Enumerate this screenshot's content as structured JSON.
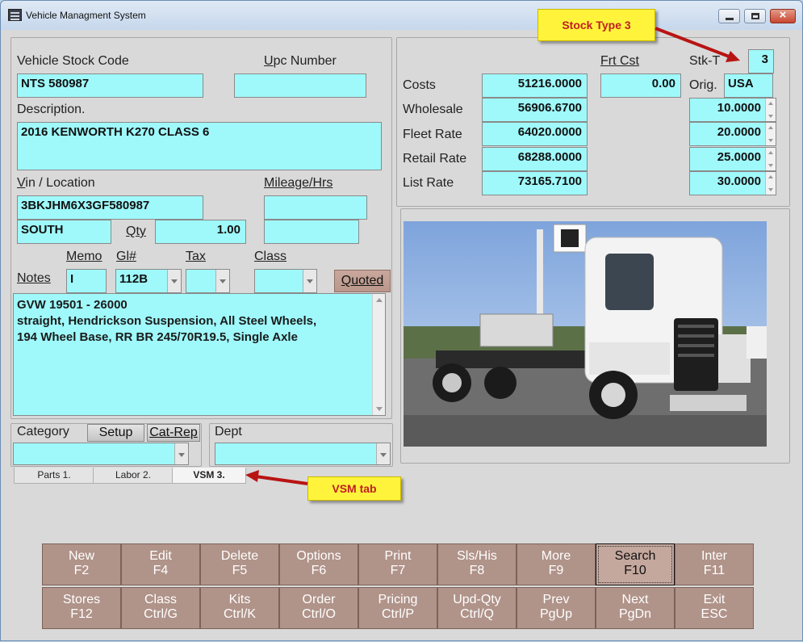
{
  "window": {
    "title": "Vehicle Managment System"
  },
  "callouts": {
    "stock_type": "Stock Type 3",
    "vsm_tab": "VSM tab"
  },
  "vehicle": {
    "stock_code_label": "Vehicle Stock Code",
    "stock_code": "NTS 580987",
    "upc_label_u": "U",
    "upc_label_rest": "pc  Number",
    "upc": "",
    "description_label": "Description.",
    "description": "2016 KENWORTH K270 CLASS 6",
    "vin_label_u": "V",
    "vin_label_rest": "in  / Location",
    "vin": "3BKJHM6X3GF580987",
    "location": "SOUTH",
    "qty_label": "Qty",
    "qty": "1.00",
    "mileage_label": "Mileage/Hrs",
    "mileage": "",
    "mileage2": ""
  },
  "notes_row": {
    "memo_label": "Memo",
    "gl_label": "Gl#",
    "tax_label": "Tax",
    "class_label": "Class",
    "notes_label": "Notes",
    "memo": "I",
    "gl": "112B",
    "tax": "",
    "class": "",
    "quoted_label": "Quoted"
  },
  "notes_text": [
    "GVW 19501 - 26000",
    "straight, Hendrickson Suspension, All Steel Wheels,",
    "194 Wheel Base, RR BR 245/70R19.5, Single Axle"
  ],
  "category": {
    "label": "Category",
    "setup_label": "Setup",
    "catrep_label": "Cat-Rep",
    "value": ""
  },
  "dept": {
    "label": "Dept",
    "value": ""
  },
  "pricing": {
    "frt_cst_label": "Frt Cst",
    "frt_cst": "0.00",
    "stkt_label": "Stk-T",
    "stkt": "3",
    "orig_label": "Orig.",
    "orig": "USA",
    "rows": [
      {
        "label": "Costs",
        "value": "51216.0000"
      },
      {
        "label": "Wholesale",
        "value": "56906.6700",
        "pct": "10.0000"
      },
      {
        "label": "Fleet Rate",
        "value": "64020.0000",
        "pct": "20.0000"
      },
      {
        "label": "Retail Rate",
        "value": "68288.0000",
        "pct": "25.0000"
      },
      {
        "label": "List Rate",
        "value": "73165.7100",
        "pct": "30.0000"
      }
    ]
  },
  "tabs": [
    {
      "label": "Parts 1."
    },
    {
      "label": "Labor 2."
    },
    {
      "label": "VSM 3."
    }
  ],
  "fkeys": [
    {
      "label": "New",
      "key": "F2"
    },
    {
      "label": "Edit",
      "key": "F4"
    },
    {
      "label": "Delete",
      "key": "F5"
    },
    {
      "label": "Options",
      "key": "F6"
    },
    {
      "label": "Print",
      "key": "F7"
    },
    {
      "label": "Sls/His",
      "key": "F8"
    },
    {
      "label": "More",
      "key": "F9"
    },
    {
      "label": "Search",
      "key": "F10"
    },
    {
      "label": "Inter",
      "key": "F11"
    },
    {
      "label": "Stores",
      "key": "F12"
    },
    {
      "label": "Class",
      "key": "Ctrl/G"
    },
    {
      "label": "Kits",
      "key": "Ctrl/K"
    },
    {
      "label": "Order",
      "key": "Ctrl/O"
    },
    {
      "label": "Pricing",
      "key": "Ctrl/P"
    },
    {
      "label": "Upd-Qty",
      "key": "Ctrl/Q"
    },
    {
      "label": "Prev",
      "key": "PgUp"
    },
    {
      "label": "Next",
      "key": "PgDn"
    },
    {
      "label": "Exit",
      "key": "ESC"
    }
  ],
  "colors": {
    "field_bg": "#9ff9fb",
    "button_bg": "#b09389",
    "callout_bg": "#fff43b",
    "callout_text": "#c02020",
    "arrow": "#b81414"
  }
}
